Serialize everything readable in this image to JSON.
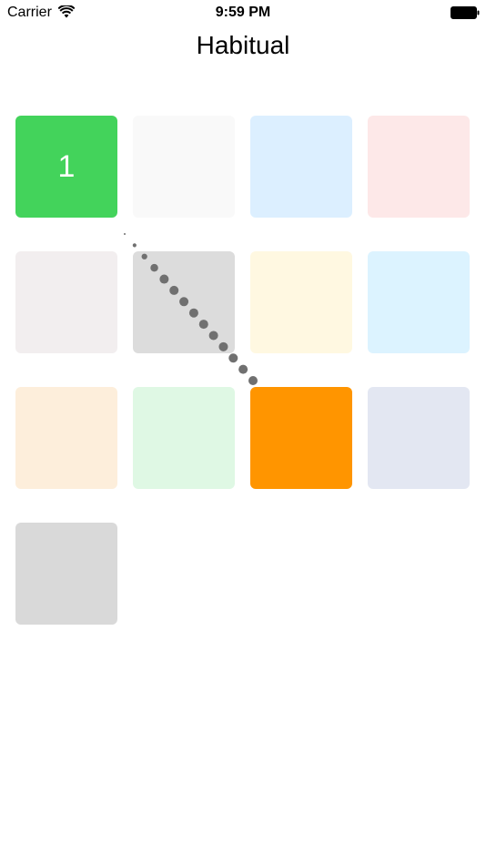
{
  "status_bar": {
    "carrier": "Carrier",
    "time": "9:59 PM",
    "icons": [
      "wifi-icon",
      "battery-icon"
    ]
  },
  "nav": {
    "title": "Habitual"
  },
  "habits": [
    {
      "color": "#43d35b",
      "count": "1"
    },
    {
      "color": "#f9f9f9",
      "count": ""
    },
    {
      "color": "#dcefff",
      "count": ""
    },
    {
      "color": "#fde8e8",
      "count": ""
    },
    {
      "color": "#f2eeef",
      "count": ""
    },
    {
      "color": "#dcdcdc",
      "count": ""
    },
    {
      "color": "#fff8e1",
      "count": ""
    },
    {
      "color": "#dcf3ff",
      "count": ""
    },
    {
      "color": "#fdeedb",
      "count": ""
    },
    {
      "color": "#dff8e4",
      "count": ""
    },
    {
      "color": "#ff9500",
      "count": ""
    },
    {
      "color": "#e3e7f2",
      "count": ""
    },
    {
      "color": "#d9d9d9",
      "count": ""
    }
  ],
  "drag_trail_color": "#707070"
}
